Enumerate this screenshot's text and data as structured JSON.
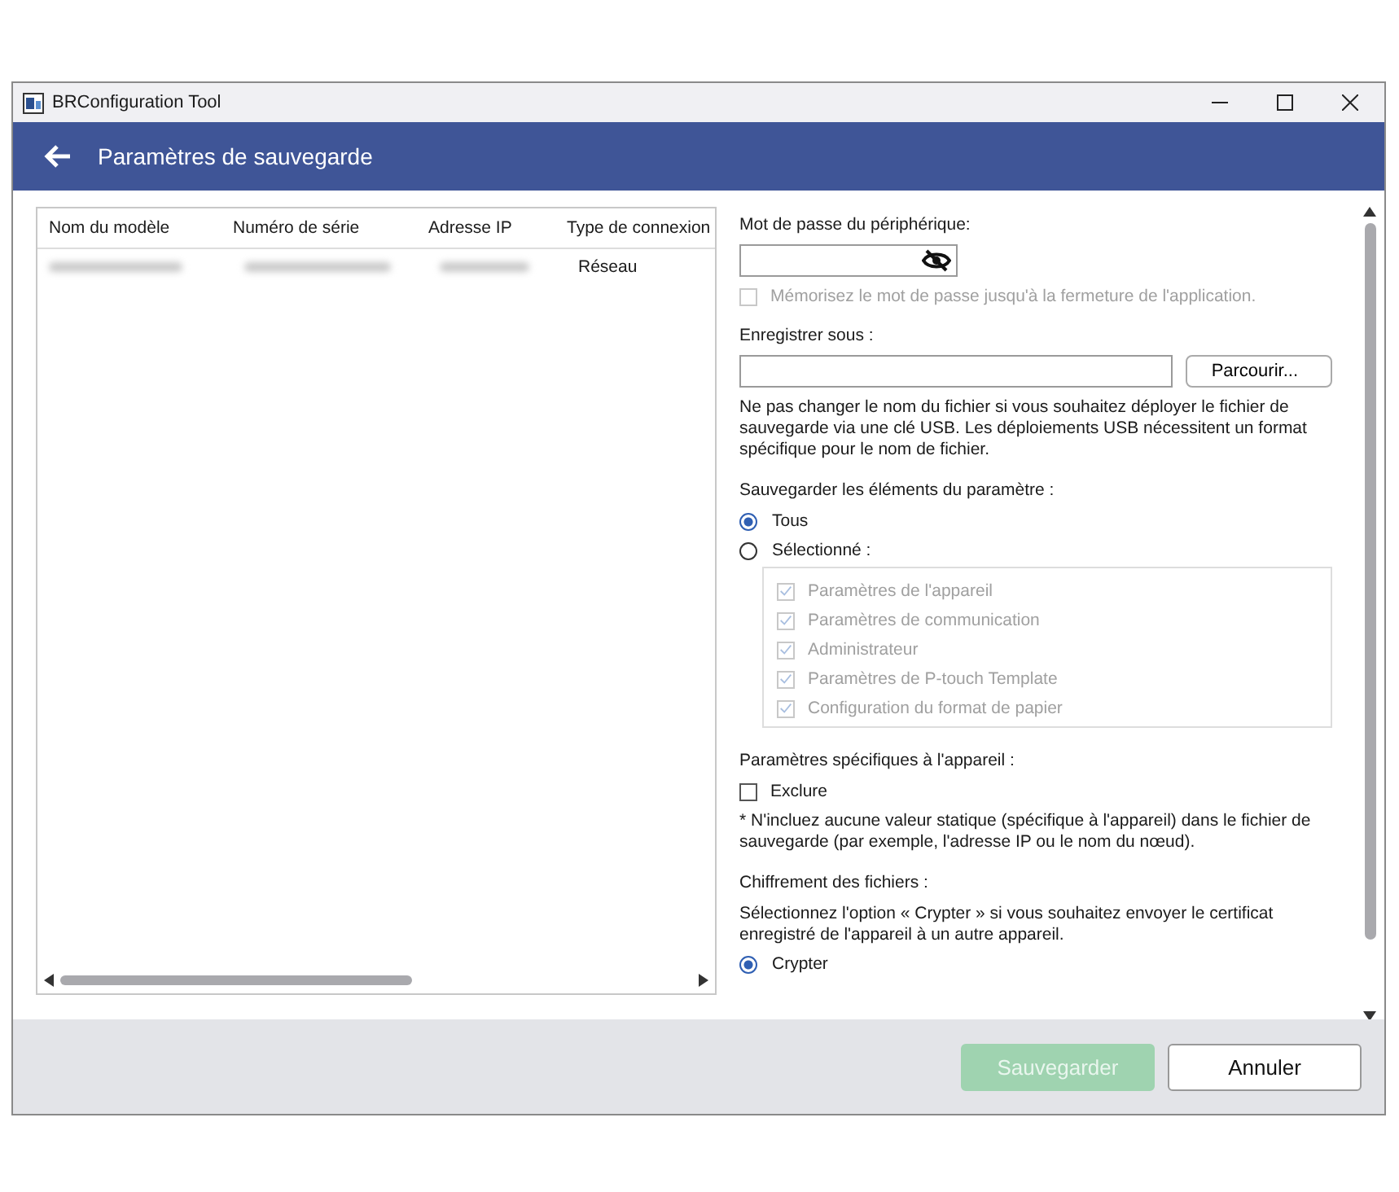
{
  "window": {
    "title": "BRConfiguration Tool"
  },
  "header": {
    "title": "Paramètres de sauvegarde"
  },
  "table": {
    "columns": [
      "Nom du modèle",
      "Numéro de série",
      "Adresse IP",
      "Type de connexion"
    ],
    "rows": [
      {
        "selected": false,
        "cells": [
          {
            "blurred": true
          },
          {
            "blurred": true
          },
          {
            "blurred": true
          },
          {
            "text": "Réseau",
            "blurred": false
          }
        ]
      }
    ]
  },
  "password": {
    "label": "Mot de passe du périphérique:",
    "remember": {
      "label": "Mémorisez le mot de passe jusqu'à la fermeture de l'application.",
      "checked": false,
      "disabled": true
    }
  },
  "save_as": {
    "label": "Enregistrer sous :",
    "browse_button": "Parcourir...",
    "note": "Ne pas changer le nom du fichier si vous souhaitez déployer le fichier de sauvegarde via une clé USB. Les déploiements USB nécessitent un format spécifique pour le nom de fichier."
  },
  "save_items": {
    "label": "Sauvegarder les éléments du paramètre :",
    "options": [
      {
        "label": "Tous",
        "selected": true
      },
      {
        "label": "Sélectionné :",
        "selected": false
      }
    ],
    "items": [
      {
        "label": "Paramètres de l'appareil",
        "checked": true,
        "disabled": true
      },
      {
        "label": "Paramètres de communication",
        "checked": true,
        "disabled": true
      },
      {
        "label": "Administrateur",
        "checked": true,
        "disabled": true
      },
      {
        "label": "Paramètres de P-touch Template",
        "checked": true,
        "disabled": true
      },
      {
        "label": "Configuration du format de papier",
        "checked": true,
        "disabled": true
      }
    ]
  },
  "device_specific": {
    "label": "Paramètres spécifiques à l'appareil :",
    "exclude": {
      "label": "Exclure",
      "checked": false
    },
    "note": "* N'incluez aucune valeur statique (spécifique à l'appareil) dans le fichier de sauvegarde (par exemple, l'adresse IP ou le nom du nœud)."
  },
  "encryption": {
    "label": "Chiffrement des fichiers :",
    "note": "Sélectionnez l'option « Crypter » si vous souhaitez envoyer le certificat enregistré de l'appareil à un autre appareil.",
    "options": [
      {
        "label": "Crypter",
        "selected": true
      }
    ]
  },
  "buttons": [
    {
      "label": "Sauvegarder",
      "disabled": true
    },
    {
      "label": "Annuler",
      "disabled": false
    }
  ]
}
